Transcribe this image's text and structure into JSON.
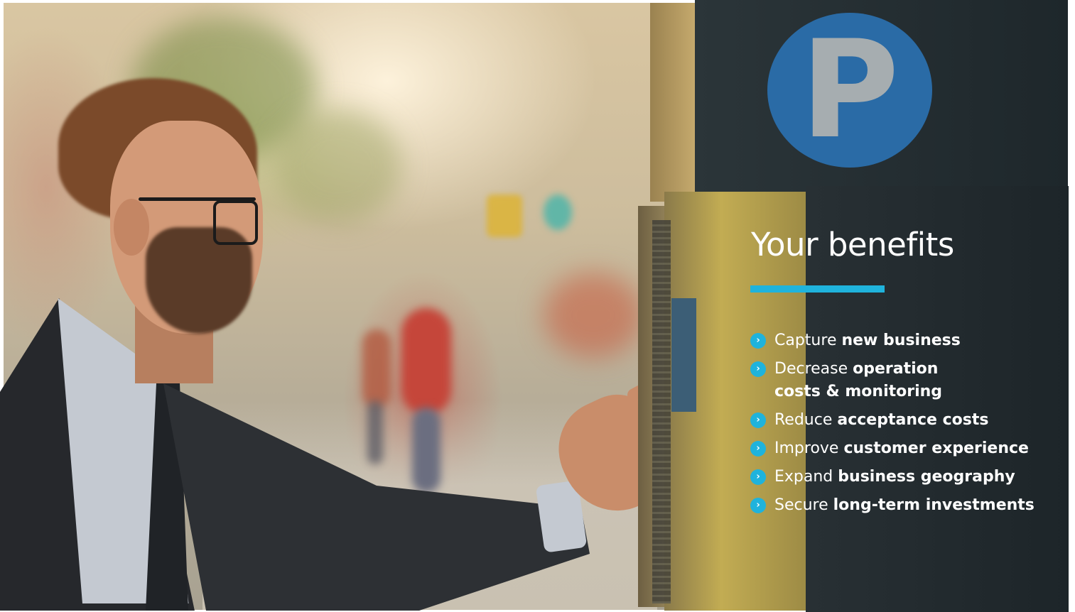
{
  "slide": {
    "heading": "Your benefits",
    "accent_color": "#1fb3dc",
    "parking_sign_letter": "P",
    "benefits": [
      {
        "prefix": "Capture ",
        "bold": "new business"
      },
      {
        "prefix": "Decrease ",
        "bold": "operation",
        "bold_line2": "costs & monitoring"
      },
      {
        "prefix": "Reduce ",
        "bold": "acceptance costs"
      },
      {
        "prefix": "Improve ",
        "bold": "customer experience"
      },
      {
        "prefix": "Expand ",
        "bold": "business geography"
      },
      {
        "prefix": "Secure ",
        "bold": "long-term investments"
      }
    ],
    "bullet_icon": "chevron-right"
  }
}
